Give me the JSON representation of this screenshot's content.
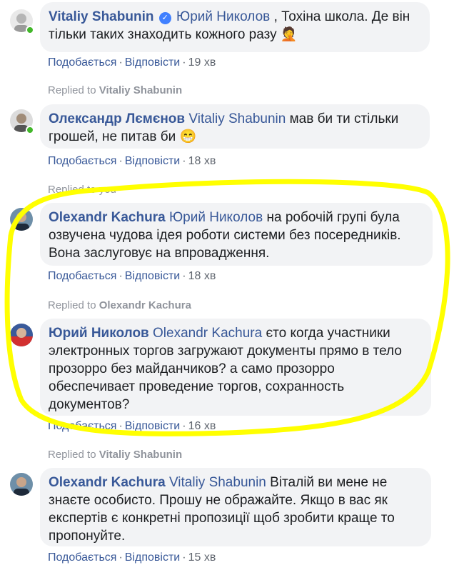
{
  "comments": [
    {
      "author": "Vitaliy Shabunin",
      "mention": "Юрий Николов",
      "text_before_emoji": ", Тохіна школа. Де він тільки таких знаходить кожного разу",
      "emoji": "🤦",
      "like": "Подобається",
      "reply": "Відповісти",
      "time": "19 хв"
    },
    {
      "replied_prefix": "Replied to",
      "replied_to": "Vitaliy Shabunin",
      "author": "Олександр Лємєнов",
      "mention": "Vitaliy Shabunin",
      "text_before_emoji": "мав би ти стільки грошей, не питав би",
      "emoji": "😁",
      "like": "Подобається",
      "reply": "Відповісти",
      "time": "18 хв"
    },
    {
      "replied_prefix": "Replied to you",
      "author": "Olexandr Kachura",
      "mention": "Юрий Николов",
      "text": "на робочій групі була озвучена чудова ідея роботи системи без посередників. Вона заслуговує на впровадження.",
      "like": "Подобається",
      "reply": "Відповісти",
      "time": "18 хв"
    },
    {
      "replied_prefix": "Replied to",
      "replied_to": "Olexandr Kachura",
      "author": "Юрий Николов",
      "mention": "Olexandr Kachura",
      "text": "єто когда участники электронных торгов загружают документы прямо в тело прозорро без майданчиков? а само прозорро обеспечивает проведение торгов, сохранность документов?",
      "like": "Подобається",
      "reply": "Відповісти",
      "time": "16 хв"
    },
    {
      "replied_prefix": "Replied to",
      "replied_to": "Vitaliy Shabunin",
      "author": "Olexandr Kachura",
      "mention": "Vitaliy Shabunin",
      "text": "Віталій ви мене не знаєте особисто. Прошу не ображайте. Якщо в вас як експертів є конкретні пропозиції щоб зробити краще то пропонуйте.",
      "like": "Подобається",
      "reply": "Відповісти",
      "time": "15 хв"
    }
  ],
  "colors": {
    "link": "#385898",
    "bubble": "#f2f3f5",
    "highlight": "#ffff00",
    "online": "#42b72a"
  }
}
